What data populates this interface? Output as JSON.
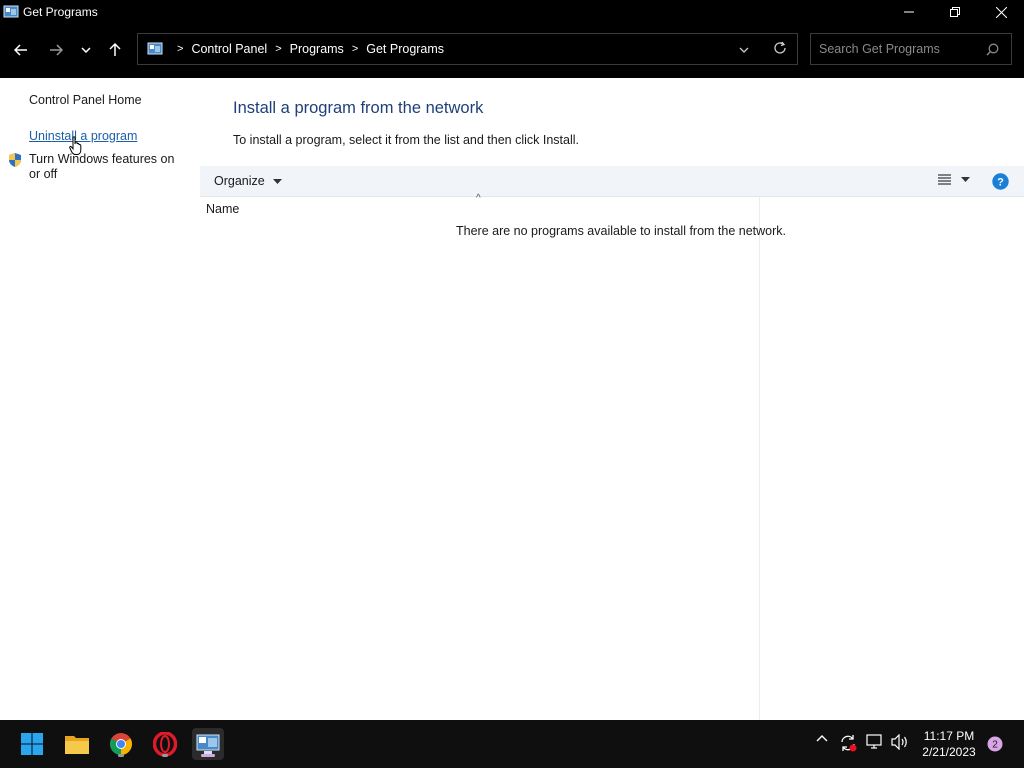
{
  "window": {
    "title": "Get Programs",
    "icon": "control-panel-icon",
    "controls": [
      "minimize-icon",
      "restore-icon",
      "close-icon"
    ]
  },
  "nav": {
    "back_icon": "back-arrow-icon",
    "forward_icon": "forward-arrow-icon",
    "recent_icon": "chevron-down-icon",
    "up_icon": "up-arrow-icon"
  },
  "address": {
    "breadcrumbs": [
      "Control Panel",
      "Programs",
      "Get Programs"
    ],
    "separator": ">"
  },
  "search": {
    "placeholder": "Search Get Programs"
  },
  "sidebar": {
    "home": "Control Panel Home",
    "uninstall": "Uninstall a program",
    "features": "Turn Windows features on or off"
  },
  "main": {
    "heading": "Install a program from the network",
    "subtext": "To install a program, select it from the list and then click Install.",
    "organize": "Organize",
    "column_name": "Name",
    "empty_message": "There are no programs available to install from the network.",
    "help": "?"
  },
  "taskbar": {
    "apps": [
      "start-icon",
      "file-explorer-icon",
      "chrome-icon",
      "opera-icon",
      "control-panel-icon"
    ],
    "time": "11:17 PM",
    "date": "2/21/2023",
    "notification_count": "2"
  },
  "colors": {
    "link": "#1c5fa8",
    "heading": "#1e3f7a",
    "toolbar_bg": "#f1f5f9",
    "help_blue": "#1a7fd6",
    "accent_pink": "#d8a6e6"
  }
}
